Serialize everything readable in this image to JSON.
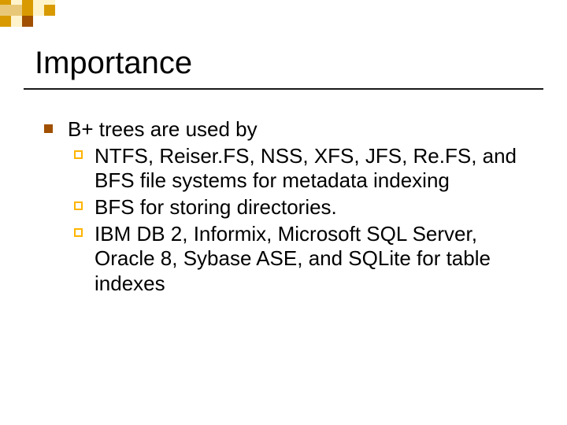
{
  "slide": {
    "title": "Importance",
    "bullet1": {
      "text": "B+ trees are used by",
      "sub": [
        "NTFS, Reiser.FS, NSS, XFS, JFS, Re.FS, and BFS file systems for metadata indexing",
        "BFS for storing directories.",
        "IBM DB 2, Informix, Microsoft SQL Server, Oracle 8, Sybase ASE, and SQLite for table indexes"
      ]
    }
  },
  "theme": {
    "accent_dark": "#a05000",
    "accent_light": "#ffb400",
    "deco_gold": "#d89a00",
    "deco_tan": "#e8c878",
    "rule": "#1a1a1a"
  }
}
